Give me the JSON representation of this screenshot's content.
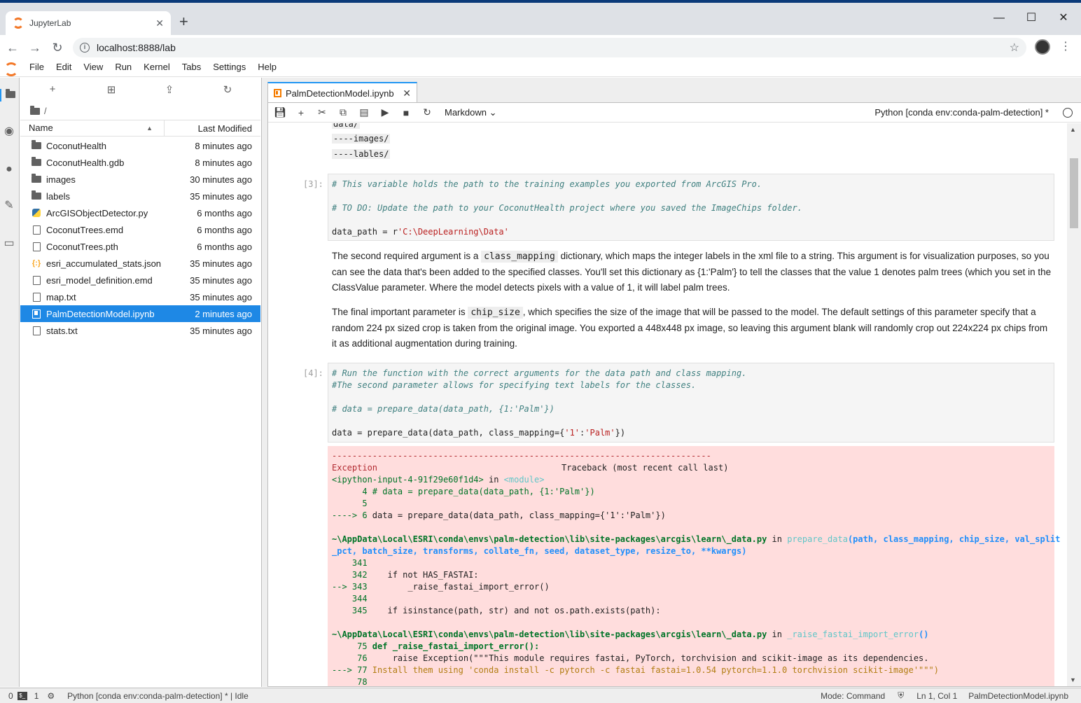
{
  "browser": {
    "tab_title": "JupyterLab",
    "url": "localhost:8888/lab"
  },
  "menu": [
    "File",
    "Edit",
    "View",
    "Run",
    "Kernel",
    "Tabs",
    "Settings",
    "Help"
  ],
  "filebrowser": {
    "breadcrumb": "/",
    "col_name": "Name",
    "col_modified": "Last Modified",
    "files": [
      {
        "name": "CoconutHealth",
        "modified": "8 minutes ago",
        "type": "folder"
      },
      {
        "name": "CoconutHealth.gdb",
        "modified": "8 minutes ago",
        "type": "folder"
      },
      {
        "name": "images",
        "modified": "30 minutes ago",
        "type": "folder"
      },
      {
        "name": "labels",
        "modified": "35 minutes ago",
        "type": "folder"
      },
      {
        "name": "ArcGISObjectDetector.py",
        "modified": "6 months ago",
        "type": "python"
      },
      {
        "name": "CoconutTrees.emd",
        "modified": "6 months ago",
        "type": "file"
      },
      {
        "name": "CoconutTrees.pth",
        "modified": "6 months ago",
        "type": "file"
      },
      {
        "name": "esri_accumulated_stats.json",
        "modified": "35 minutes ago",
        "type": "json"
      },
      {
        "name": "esri_model_definition.emd",
        "modified": "35 minutes ago",
        "type": "file"
      },
      {
        "name": "map.txt",
        "modified": "35 minutes ago",
        "type": "file"
      },
      {
        "name": "PalmDetectionModel.ipynb",
        "modified": "2 minutes ago",
        "type": "notebook",
        "selected": true
      },
      {
        "name": "stats.txt",
        "modified": "35 minutes ago",
        "type": "file"
      }
    ]
  },
  "notebook": {
    "tab_title": "PalmDetectionModel.ipynb",
    "cell_type": "Markdown",
    "kernel": "Python [conda env:conda-palm-detection] *",
    "top_lines": [
      "data/",
      "----images/",
      "----lables/"
    ],
    "cell3": {
      "prompt": "[3]:",
      "line1": "# This variable holds the path to the training examples you exported from ArcGIS Pro.",
      "line2": "# TO DO: Update the path to your CoconutHealth project where you saved the ImageChips folder.",
      "line3a": "data_path = r",
      "line3b": "'C:\\DeepLearning\\Data'"
    },
    "md1": {
      "a": "The second required argument is a ",
      "code": "class_mapping",
      "b": " dictionary, which maps the integer labels in the xml file to a string. This argument is for visualization purposes, so you can see the data that's been added to the specified classes. You'll set this dictionary as {1:'Palm'} to tell the classes that the value 1 denotes palm trees (which you set in the ClassValue parameter. Where the model detects pixels with a value of 1, it will label palm trees."
    },
    "md2": {
      "a": "The final important parameter is ",
      "code": "chip_size",
      "b": ", which specifies the size of the image that will be passed to the model. The default settings of this parameter specify that a random 224 px sized crop is taken from the original image. You exported a 448x448 px image, so leaving this argument blank will randomly crop out 224x224 px chips from it as additional augmentation during training."
    },
    "cell4": {
      "prompt": "[4]:",
      "line1": "# Run the function with the correct arguments for the data path and class mapping.",
      "line2": "#The second parameter allows for specifying text labels for the classes.",
      "line3": "# data = prepare_data(data_path, {1:'Palm'})",
      "line4a": "data = prepare_data(data_path, class_mapping={",
      "line4b": "'1'",
      "line4c": ":",
      "line4d": "'Palm'",
      "line4e": "})"
    },
    "error": {
      "dashes": "---------------------------------------------------------------------------",
      "exc": "Exception",
      "tb": "Traceback (most recent call last)",
      "input": "<ipython-input-4-91f29e60f1d4>",
      "in": " in ",
      "module": "<module>",
      "l4": "      4 # data = prepare_data(data_path, {1:'Palm'})",
      "l5": "      5",
      "l6arrow": "----> 6 ",
      "l6": "data = prepare_data(data_path, class_mapping={'1':'Palm'})",
      "path1": "~\\AppData\\Local\\ESRI\\conda\\envs\\palm-detection\\lib\\site-packages\\arcgis\\learn\\_data.py",
      "fn1": "prepare_data",
      "args1a": "(path, class_mapping, chip_size, val_split",
      "args1b": "_pct, batch_size, transforms, collate_fn, seed, dataset_type, resize_to, **kwargs)",
      "n341": "    341",
      "n342": "    342",
      "c342": "    if not HAS_FASTAI:",
      "n343": "--> 343",
      "c343": "        _raise_fastai_import_error()",
      "n344": "    344",
      "n345": "    345",
      "c345": "    if isinstance(path, str) and not os.path.exists(path):",
      "fn2": "_raise_fastai_import_error",
      "args2": "()",
      "n75": "     75",
      "c75": " def _raise_fastai_import_error():",
      "n76": "     76",
      "c76": "     raise Exception(\"\"\"This module requires fastai, PyTorch, torchvision and scikit-image as its dependencies.",
      "n77": "---> 77",
      "c77": " Install them using 'conda install -c pytorch -c fastai fastai=1.0.54 pytorch=1.1.0 torchvision scikit-image'\"\"\")",
      "n78": "     78"
    }
  },
  "status": {
    "count0": "0",
    "count1": "1",
    "kernel": "Python [conda env:conda-palm-detection] * | Idle",
    "mode": "Mode: Command",
    "position": "Ln 1, Col 1",
    "file": "PalmDetectionModel.ipynb"
  }
}
